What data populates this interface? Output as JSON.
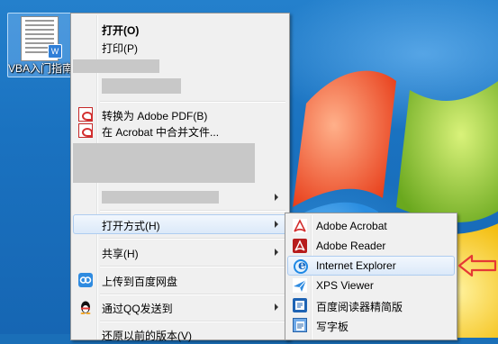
{
  "desktop": {
    "icon_label": "VBA入门指南"
  },
  "context_menu": {
    "items": [
      {
        "label": "打开(O)"
      },
      {
        "label": "打印(P)"
      },
      {
        "label": "转换为 Adobe PDF(B)"
      },
      {
        "label": "在 Acrobat 中合并文件..."
      },
      {
        "label": "打开方式(H)"
      },
      {
        "label": "共享(H)"
      },
      {
        "label": "上传到百度网盘"
      },
      {
        "label": "通过QQ发送到"
      },
      {
        "label": "还原以前的版本(V)"
      }
    ]
  },
  "open_with_submenu": {
    "items": [
      {
        "label": "Adobe Acrobat",
        "icon": "adobe-acrobat-icon"
      },
      {
        "label": "Adobe Reader",
        "icon": "adobe-reader-icon"
      },
      {
        "label": "Internet Explorer",
        "icon": "internet-explorer-icon"
      },
      {
        "label": "XPS Viewer",
        "icon": "xps-viewer-icon"
      },
      {
        "label": "百度阅读器精简版",
        "icon": "baidu-reader-icon"
      },
      {
        "label": "写字板",
        "icon": "wordpad-icon"
      }
    ]
  },
  "colors": {
    "menu_bg": "#f0f0f0",
    "hover_border": "#aeccf0",
    "annotation_arrow": "#e53935",
    "desktop_blue": "#1a72c0"
  }
}
